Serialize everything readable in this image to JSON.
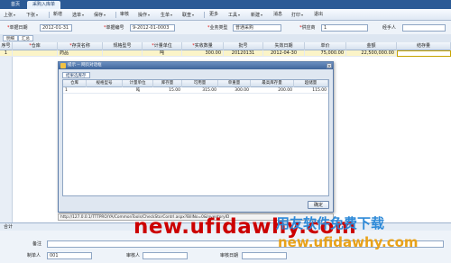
{
  "tabs": [
    "首页",
    "采购入库单"
  ],
  "toolbar": {
    "buttons": [
      {
        "label": "上张",
        "caret": true
      },
      {
        "label": "下张",
        "caret": true
      },
      {
        "label": "新增",
        "caret": false
      },
      {
        "label": "选单",
        "caret": true
      },
      {
        "label": "保存",
        "caret": true
      },
      {
        "label": "审核",
        "caret": false
      },
      {
        "label": "操作",
        "caret": true
      },
      {
        "label": "生单",
        "caret": true
      },
      {
        "label": "联查",
        "caret": true
      },
      {
        "label": "更多",
        "caret": false
      },
      {
        "label": "工具",
        "caret": true
      },
      {
        "label": "新建",
        "caret": true
      },
      {
        "label": "消息",
        "caret": false
      },
      {
        "label": "打印",
        "caret": true
      },
      {
        "label": "退出",
        "caret": false
      }
    ]
  },
  "header_form": {
    "date_label": "单据日期",
    "date_value": "2012-01-31",
    "code_label": "单据编号",
    "code_value": "9-2012-01-0003",
    "biz_type_label": "业务类型",
    "biz_type_value": "普通采购",
    "supplier_label": "供应商",
    "supplier_value": "1",
    "handler_label": "经手人",
    "handler_value": ""
  },
  "sub_tabs": [
    "明细",
    "汇总"
  ],
  "grid": {
    "columns": [
      "序号",
      "仓库",
      "存货名称",
      "规格型号",
      "计量单位",
      "实收数量",
      "批号",
      "失效日期",
      "单价",
      "金额",
      "结存量"
    ],
    "rows": [
      [
        "1",
        "",
        "药品",
        "",
        "吨",
        "300.00",
        "20120131",
        "2012-04-30",
        "75,000.00",
        "22,500,000.00",
        ""
      ]
    ]
  },
  "dialog": {
    "title": "提示 -- 网页对话框",
    "close": "×",
    "tab": "结果选库存",
    "columns": [
      "仓库",
      "规格型号",
      "计量单位",
      "库存量",
      "可用量",
      "单重量",
      "最高库存量",
      "超储量"
    ],
    "rows": [
      [
        "1",
        "",
        "吨",
        "15.00",
        "315.00",
        "300.00",
        "200.00",
        "115.00"
      ]
    ],
    "ok_label": "确定"
  },
  "url_bar": "http://127.0.0.1/TTTPRO/YA/CommonTools/CheckStorContrl.aspx?BillNo=0&InventoryID",
  "totals_label": "合计",
  "bottom_form": {
    "remark_label": "备注",
    "maker_label": "制单人",
    "maker_value": "001",
    "auditor_label": "审核人",
    "auditor_value": "",
    "audit_date_label": "审核日期",
    "audit_date_value": ""
  },
  "watermarks": {
    "url_text": "new.ufidawhy.com",
    "brand_cn": "用友软件免费下载",
    "brand_url": "new.ufidawhy.com"
  }
}
